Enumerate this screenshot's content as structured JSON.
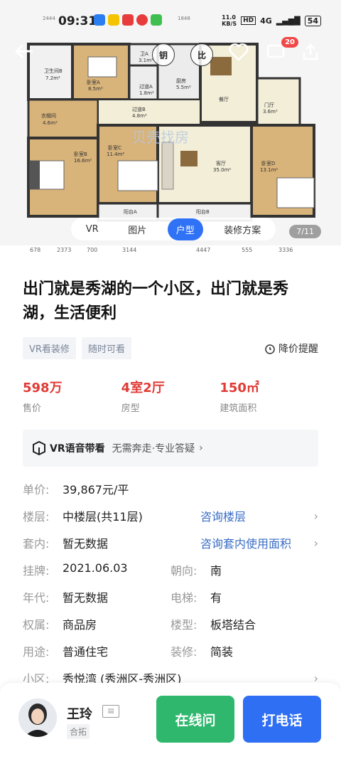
{
  "status_bar": {
    "time": "09:31",
    "network_speed": "11.0\nKB/S",
    "signal": "4G",
    "battery": "54"
  },
  "hero": {
    "rooms": [
      "卫生间B",
      "卧室A",
      "卫A",
      "过道A",
      "厨房",
      "餐厅",
      "门厅",
      "衣帽间",
      "过道B",
      "卧室C",
      "客厅",
      "卧室B",
      "卧室D",
      "阳台A",
      "阳台B"
    ],
    "room_areas": [
      "7.2m²",
      "8.5m²",
      "3.1m²",
      "1.8m²",
      "5.5m²",
      "3.6m²",
      "4.6m²",
      "4.8m²",
      "11.4m²",
      "35.0m²",
      "16.6m²",
      "13.1m²"
    ],
    "watermark": "贝壳找房",
    "notification_count": "20",
    "media_tabs": [
      {
        "label": "VR",
        "active": false
      },
      {
        "label": "图片",
        "active": false
      },
      {
        "label": "户型",
        "active": true
      },
      {
        "label": "装修方案",
        "active": false
      }
    ],
    "counter": "7/11",
    "dimensions": [
      "678",
      "2373",
      "700",
      "3144",
      "4447",
      "555",
      "3336"
    ],
    "top_dimensions": [
      "2444",
      "1848"
    ]
  },
  "listing": {
    "title": "出门就是秀湖的一个小区，出门就是秀湖，生活便利",
    "tags": [
      "VR看装修",
      "随时可看"
    ],
    "price_alert": "降价提醒",
    "stats": [
      {
        "value": "598万",
        "label": "售价"
      },
      {
        "value": "4室2厅",
        "label": "房型"
      },
      {
        "value": "150㎡",
        "label": "建筑面积"
      }
    ],
    "vr_banner": {
      "title": "VR语音带看",
      "subtitle": "无需奔走·专业答疑"
    }
  },
  "info_rows": [
    {
      "k1": "单价:",
      "v1": "39,867元/平"
    },
    {
      "k1": "楼层:",
      "v1": "中楼层(共11层)",
      "v2": "咨询楼层",
      "link": true
    },
    {
      "k1": "套内:",
      "v1": "暂无数据",
      "v2": "咨询套内使用面积",
      "link": true
    },
    {
      "k1": "挂牌:",
      "v1": "2021.06.03",
      "k2": "朝向:",
      "v2": "南"
    },
    {
      "k1": "年代:",
      "v1": "暂无数据",
      "k2": "电梯:",
      "v2": "有"
    },
    {
      "k1": "权属:",
      "v1": "商品房",
      "k2": "楼型:",
      "v2": "板塔结合"
    },
    {
      "k1": "用途:",
      "v1": "普通住宅",
      "k2": "装修:",
      "v2": "简装"
    },
    {
      "k1": "小区:",
      "v1": "秀悦湾 (秀洲区-秀洲区)",
      "chevron": true
    }
  ],
  "agent": {
    "name": "王玲",
    "company": "合拓",
    "chat_label": "在线问",
    "call_label": "打电话"
  }
}
